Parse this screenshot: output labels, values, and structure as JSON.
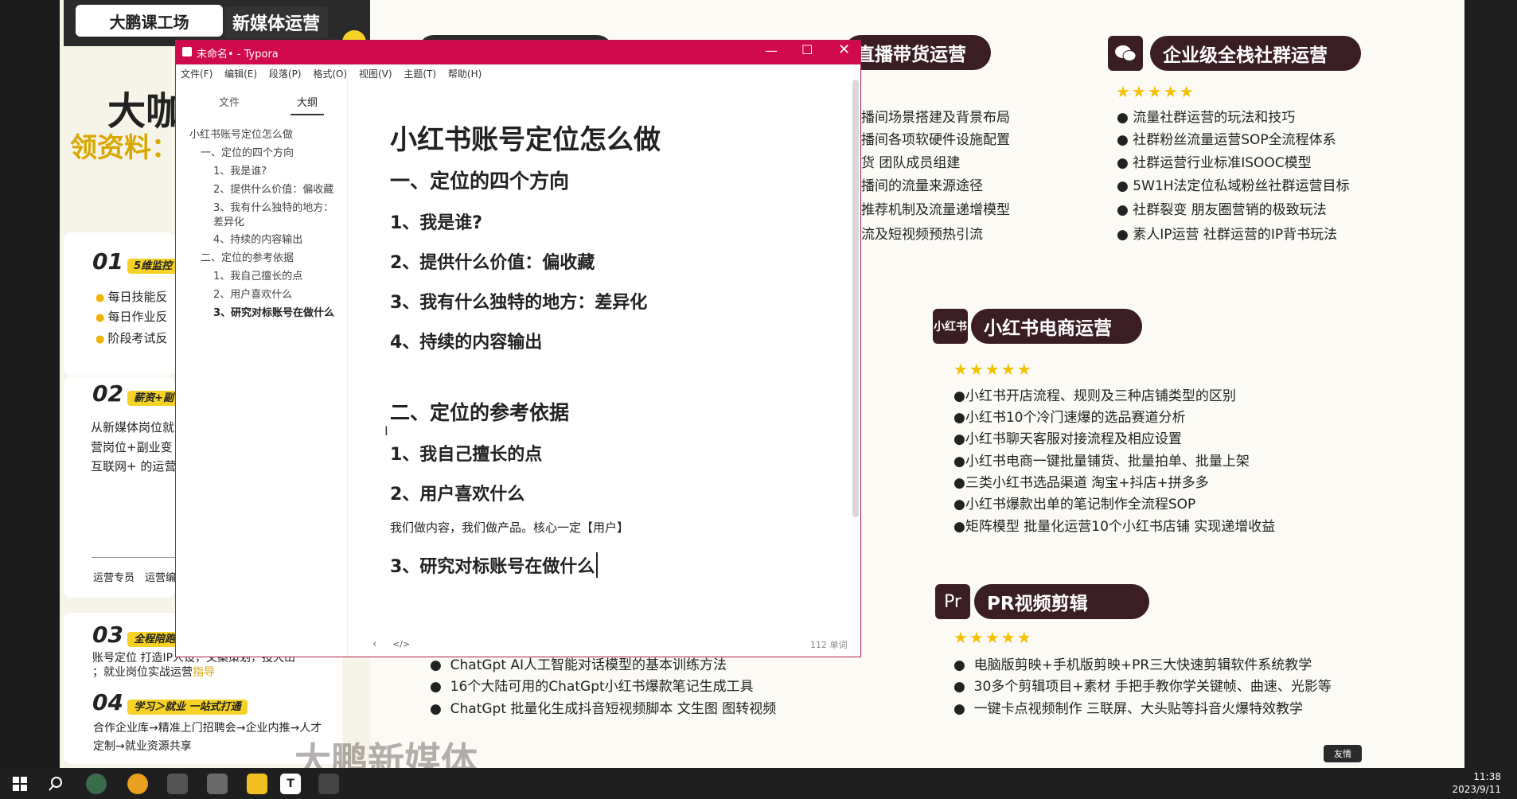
{
  "left_panel": {
    "logo": "大鹏课工场",
    "topic": "新媒体运营",
    "headline": "大咖",
    "sub": "领资料：",
    "sections": [
      {
        "num": "01",
        "tag": "5维监控",
        "items": [
          "每日技能反",
          "每日作业反",
          "阶段考试反"
        ]
      },
      {
        "num": "02",
        "tag": "薪资+副",
        "lines": [
          "从新媒体岗位就",
          "营岗位+副业变",
          "互联网+ 的运营"
        ],
        "roles": [
          "运营专员",
          "运营编"
        ]
      },
      {
        "num": "03",
        "tag": "全程陪跑",
        "lines": [
          "账号定位 打造IP人设，文案策划，投大山",
          "；就业岗位实战运营"
        ],
        "highlight": "指导"
      },
      {
        "num": "04",
        "tag": "学习＞就业 一站式打通",
        "lines": [
          "合作企业库→精准上门招聘会→企业内推→人才",
          "定制→就业资源共享"
        ]
      }
    ],
    "watermark": "大鹏新媒体"
  },
  "right_panel": {
    "live": {
      "title": "直播带货运营",
      "items": [
        "播间场景搭建及背景布局",
        "播间各项软硬件设施配置",
        "货 团队成员组建",
        "播间的流量来源途径",
        "推荐机制及流量递增模型",
        "流及短视频预热引流"
      ]
    },
    "community": {
      "title": "企业级全栈社群运营",
      "stars": "★★★★★",
      "items": [
        "流量社群运营的玩法和技巧",
        "社群粉丝流量运营SOP全流程体系",
        "社群运营行业标准ISOOC模型",
        "5W1H法定位私域粉丝社群运营目标",
        "社群裂变 朋友圈营销的极致玩法",
        "素人IP运营 社群运营的IP背书玩法"
      ]
    },
    "xhs": {
      "icon": "小红书",
      "title": "小红书电商运营",
      "stars": "★★★★★",
      "items": [
        "小红书开店流程、规则及三种店铺类型的区别",
        "小红书10个冷门速爆的选品赛道分析",
        "小红书聊天客服对接流程及相应设置",
        "小红书电商一键批量铺货、批量拍单、批量上架",
        "三类小红书选品渠道 淘宝+抖店+拼多多",
        "小红书爆款出单的笔记制作全流程SOP",
        "矩阵模型 批量化运营10个小红书店铺 实现递增收益"
      ]
    },
    "chatgpt": {
      "items": [
        "ChatGpt AI人工智能对话模型的基本训练方法",
        "16个大陆可用的ChatGpt小红书爆款笔记生成工具",
        "ChatGpt 批量化生成抖音短视频脚本 文生图 图转视频"
      ]
    },
    "pr": {
      "icon": "Pr",
      "title": "PR视频剪辑",
      "stars": "★★★★★",
      "items": [
        "电脑版剪映+手机版剪映+PR三大快速剪辑软件系统教学",
        "30多个剪辑项目+素材 手把手教你学关键帧、曲速、光影等",
        "一键卡点视频制作 三联屏、大头贴等抖音火爆特效教学"
      ]
    },
    "corner_btn": "友情"
  },
  "typora": {
    "title": "未命名• - Typora",
    "menu": [
      "文件(F)",
      "编辑(E)",
      "段落(P)",
      "格式(O)",
      "视图(V)",
      "主题(T)",
      "帮助(H)"
    ],
    "tabs": [
      "文件",
      "大纲"
    ],
    "outline": [
      {
        "text": "小红书账号定位怎么做",
        "level": 0
      },
      {
        "text": "一、定位的四个方向",
        "level": 1
      },
      {
        "text": "1、我是谁?",
        "level": 2
      },
      {
        "text": "2、提供什么价值：偏收藏",
        "level": 2
      },
      {
        "text": "3、我有什么独特的地方：",
        "level": 2
      },
      {
        "text": "差异化",
        "level": 2
      },
      {
        "text": "4、持续的内容输出",
        "level": 2
      },
      {
        "text": "二、定位的参考依据",
        "level": 1
      },
      {
        "text": "1、我自己擅长的点",
        "level": 2
      },
      {
        "text": "2、用户喜欢什么",
        "level": 2
      },
      {
        "text": "3、研究对标账号在做什么",
        "level": 2
      }
    ],
    "doc": {
      "h1": "小红书账号定位怎么做",
      "s1": "一、定位的四个方向",
      "s1_items": [
        "1、我是谁?",
        "2、提供什么价值：偏收藏",
        "3、我有什么独特的地方：差异化",
        "4、持续的内容输出"
      ],
      "s2": "二、定位的参考依据",
      "s2_item1": "1、我自己擅长的点",
      "s2_item2": "2、用户喜欢什么",
      "para": "我们做内容，我们做产品。核心一定【用户】",
      "s2_item3": "3、研究对标账号在做什么"
    },
    "statusbar": {
      "left": "‹",
      "code": "</>",
      "words": "112 单词"
    }
  },
  "taskbar": {
    "time": "11:38",
    "date": "2023/9/11"
  }
}
